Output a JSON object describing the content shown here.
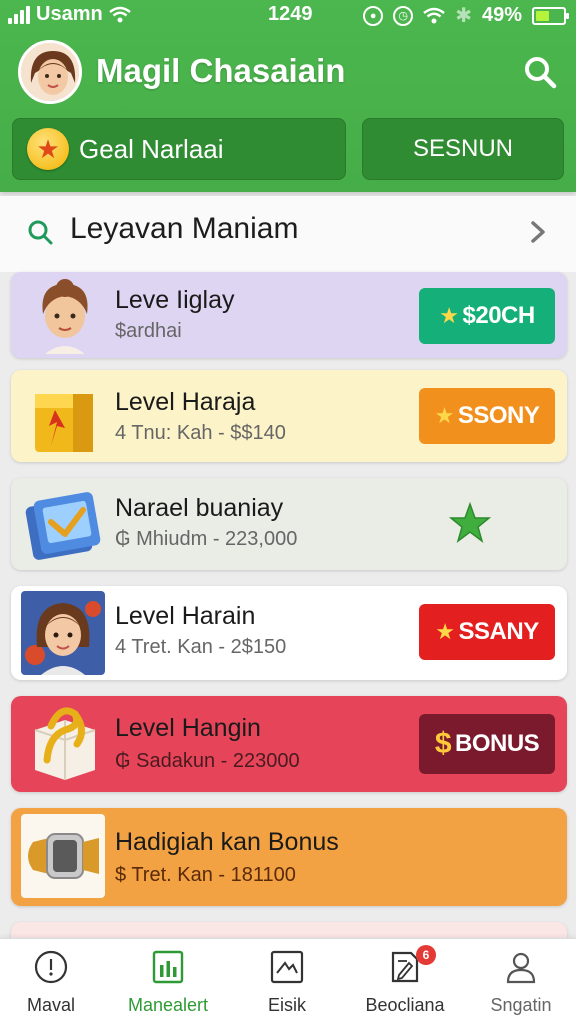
{
  "status_bar": {
    "carrier": "Usamn",
    "time": "1249",
    "battery": "49%",
    "battery_level": 0.49
  },
  "header": {
    "title": "Magil Chasaiain",
    "goal_button_label": "Geal Narlaai",
    "season_button_label": "SESNUN"
  },
  "section": {
    "title": "Leyavan Maniam"
  },
  "items": [
    {
      "title": "Leve Iiglay",
      "subtitle": "$ardhai",
      "button": "$20CH",
      "button_icon": "star",
      "color": "#15b07a",
      "bg": "#ddd5f2",
      "icon": "avatar-woman-icon"
    },
    {
      "title": "Level Haraja",
      "subtitle": "4 Tnu: Kah - $$140",
      "button": "SSONY",
      "button_icon": "star",
      "color": "#f2901e",
      "bg": "#fdf3c9",
      "icon": "gift-box-icon"
    },
    {
      "title": "Narael buaniay",
      "subtitle": "Mhiudm - 223,000",
      "subtitle_icon": "₲",
      "button": "",
      "button_icon": "star",
      "color": "",
      "bg": "#eaece6",
      "icon": "chart-card-icon"
    },
    {
      "title": "Level Harain",
      "subtitle": "4 Tret. Kan - 2$150",
      "button": "SSANY",
      "button_icon": "star",
      "color": "#e31f1f",
      "bg": "#ffffff",
      "icon": "avatar-girl-icon"
    },
    {
      "title": "Level Hangin",
      "subtitle": "Sadakun - 223000",
      "subtitle_icon": "₲",
      "button": "BONUS",
      "button_icon": "$",
      "color": "#7a1a2c",
      "bg": "#e64559",
      "icon": "gift-box-ribbon-icon"
    },
    {
      "title": "Hadigiah kan Bonus",
      "subtitle": "Tret. Kan - 181100",
      "subtitle_icon": "$",
      "button": "",
      "button_icon": "",
      "color": "",
      "bg": "#f2a242",
      "icon": "watch-icon"
    }
  ],
  "bottom_nav": [
    {
      "label": "Maval",
      "icon": "compass-icon",
      "active": false
    },
    {
      "label": "Manealert",
      "icon": "chart-doc-icon",
      "active": true
    },
    {
      "label": "Eisik",
      "icon": "image-icon",
      "active": false
    },
    {
      "label": "Beocliana",
      "icon": "doc-edit-icon",
      "active": false,
      "badge": "6"
    },
    {
      "label": "Sngatin",
      "icon": "person-icon",
      "active": false
    }
  ]
}
